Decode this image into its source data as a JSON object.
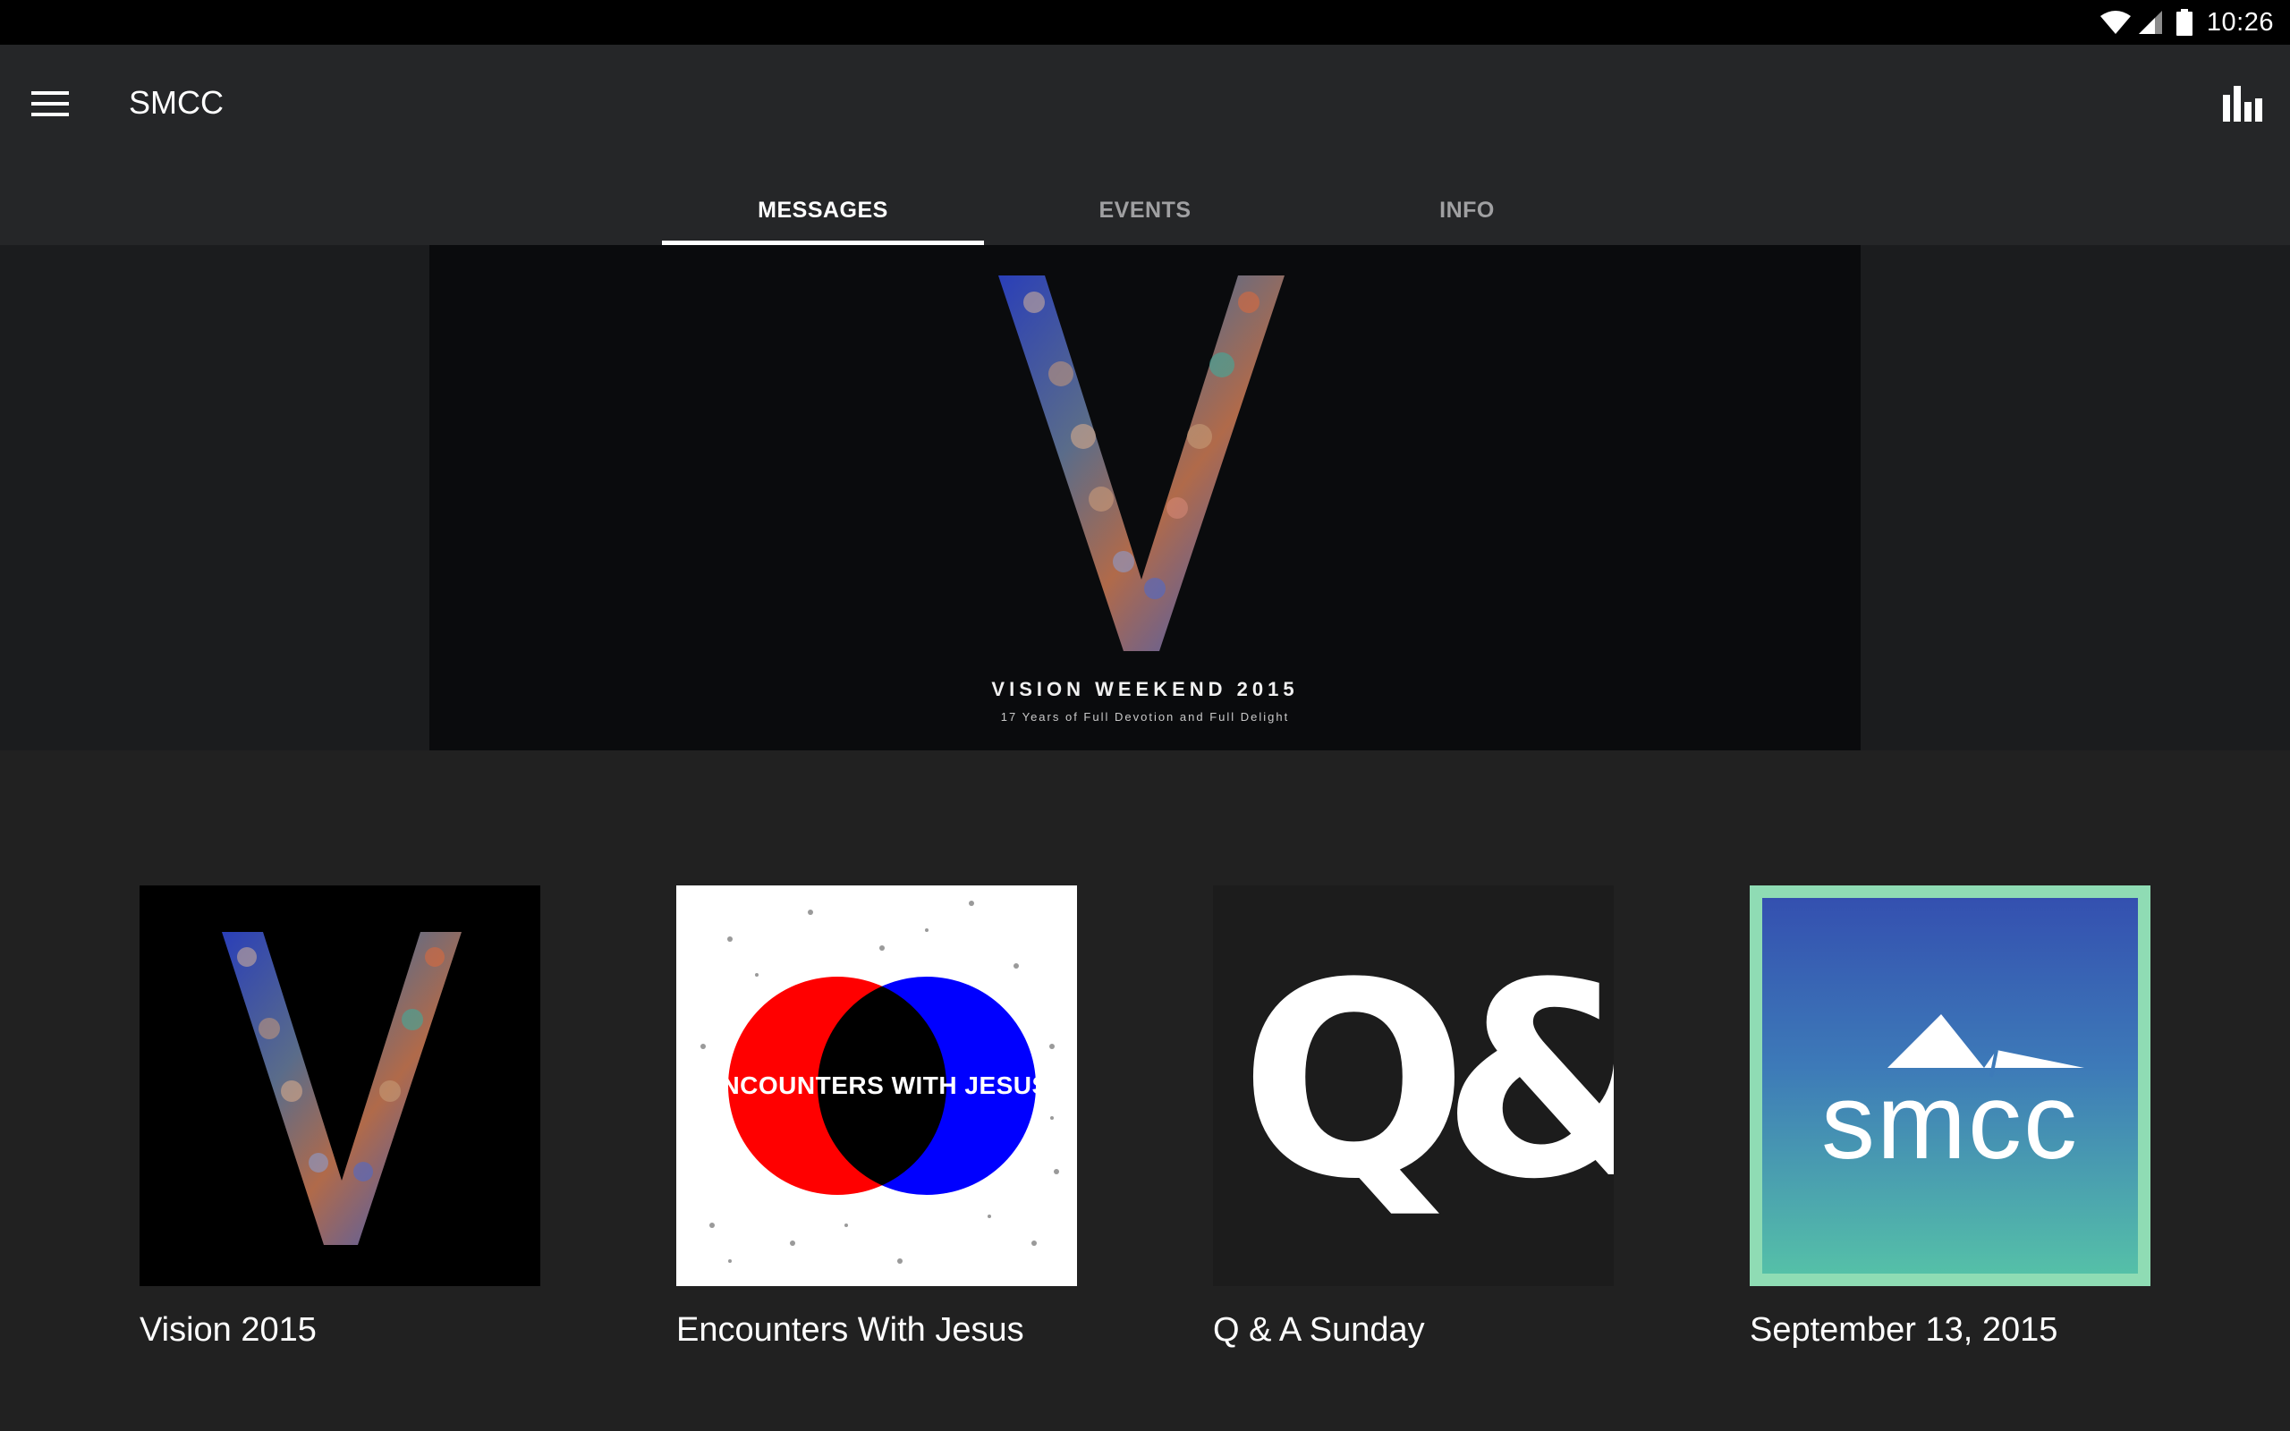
{
  "status_bar": {
    "time": "10:26"
  },
  "app_bar": {
    "title": "SMCC"
  },
  "tabs": [
    {
      "label": "MESSAGES",
      "active": true
    },
    {
      "label": "EVENTS",
      "active": false
    },
    {
      "label": "INFO",
      "active": false
    }
  ],
  "banner": {
    "title": "VISION WEEKEND 2015",
    "subtitle": "17 Years of Full Devotion and Full Delight"
  },
  "series": [
    {
      "label": "Vision 2015"
    },
    {
      "label": "Encounters With Jesus",
      "art_text": "ENCOUNTERS WITH JESUS"
    },
    {
      "label": "Q & A Sunday",
      "art_text": "Q&A"
    },
    {
      "label": "September 13, 2015",
      "art_text": "smcc"
    }
  ],
  "colors": {
    "status_bar": "#000000",
    "app_bar": "#252628",
    "background": "#212121",
    "tab_active": "#ffffff",
    "tab_inactive": "#a0a0a2"
  }
}
